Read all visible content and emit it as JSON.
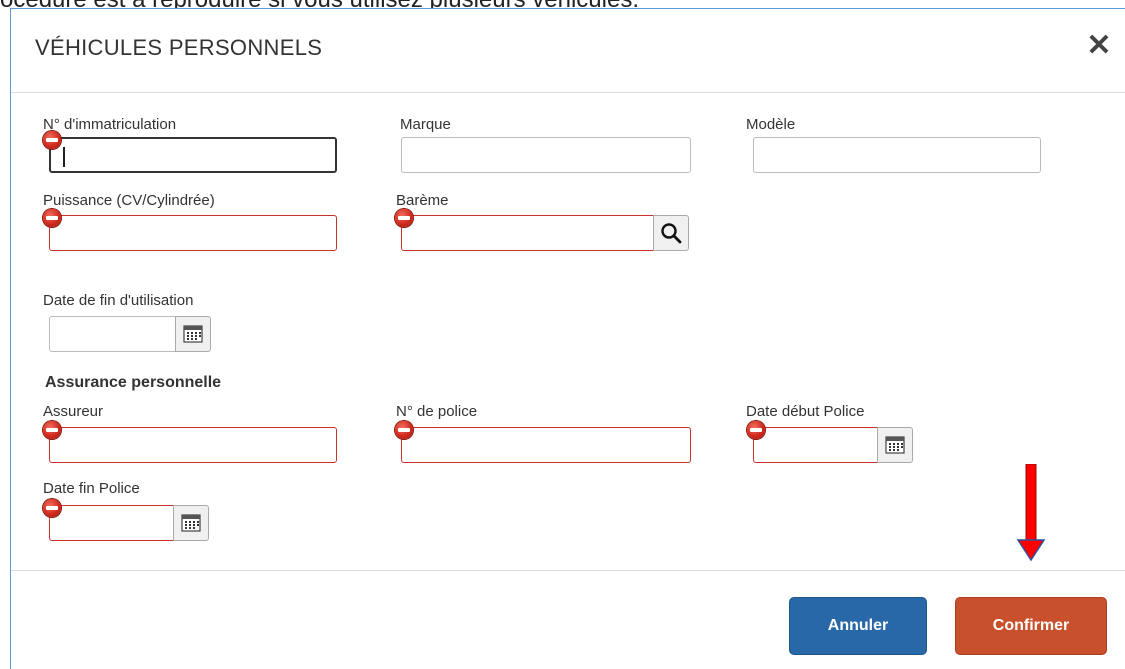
{
  "background_text": "océdure est à reproduire si vous utilisez plusieurs véhicules.",
  "dialog": {
    "title": "VÉHICULES PERSONNELS",
    "close_glyph": "✕"
  },
  "fields": {
    "immatriculation": {
      "label": "N° d'immatriculation",
      "value": "",
      "required": true,
      "focused": true
    },
    "marque": {
      "label": "Marque",
      "value": ""
    },
    "modele": {
      "label": "Modèle",
      "value": ""
    },
    "puissance": {
      "label": "Puissance (CV/Cylindrée)",
      "value": "",
      "required": true
    },
    "bareme": {
      "label": "Barème",
      "value": "",
      "required": true
    },
    "date_fin_utilisation": {
      "label": "Date de fin d'utilisation",
      "value": ""
    }
  },
  "assurance": {
    "heading": "Assurance personnelle",
    "assureur": {
      "label": "Assureur",
      "value": "",
      "required": true
    },
    "numero_police": {
      "label": "N° de police",
      "value": "",
      "required": true
    },
    "date_debut_police": {
      "label": "Date début Police",
      "value": "",
      "required": true
    },
    "date_fin_police": {
      "label": "Date fin Police",
      "value": "",
      "required": true
    }
  },
  "buttons": {
    "cancel": "Annuler",
    "confirm": "Confirmer"
  },
  "colors": {
    "required_border": "#c9302c",
    "cancel_bg": "#2868a8",
    "confirm_bg": "#c9502c",
    "arrow": "#ff0000"
  },
  "icons": {
    "required": "required-field-icon",
    "search": "search-icon",
    "calendar": "calendar-icon",
    "close": "close-icon",
    "annotation": "red-arrow-down-icon"
  }
}
